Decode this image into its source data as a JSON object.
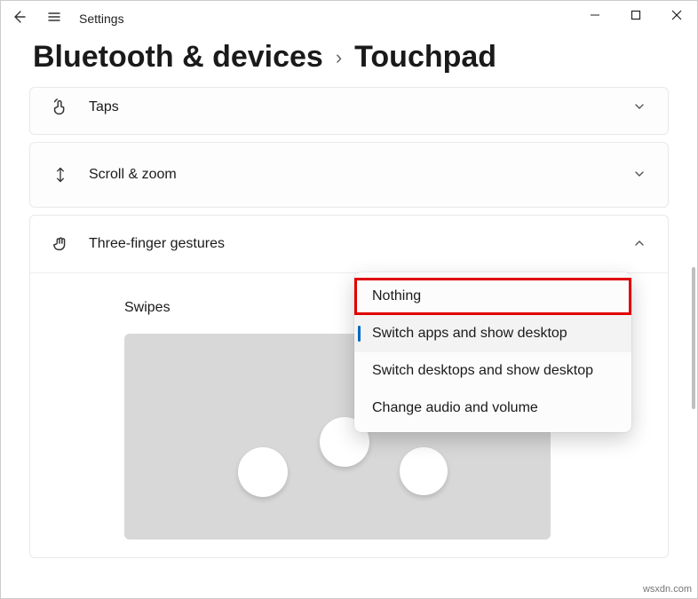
{
  "app": {
    "title": "Settings"
  },
  "breadcrumb": {
    "parent": "Bluetooth & devices",
    "current": "Touchpad"
  },
  "cards": {
    "taps": {
      "label": "Taps"
    },
    "scroll_zoom": {
      "label": "Scroll & zoom"
    },
    "three_finger": {
      "label": "Three-finger gestures",
      "swipes_label": "Swipes"
    }
  },
  "dropdown": {
    "options": [
      "Nothing",
      "Switch apps and show desktop",
      "Switch desktops and show desktop",
      "Change audio and volume"
    ],
    "selected_index": 1,
    "highlighted_index": 0
  },
  "watermark": "wsxdn.com"
}
